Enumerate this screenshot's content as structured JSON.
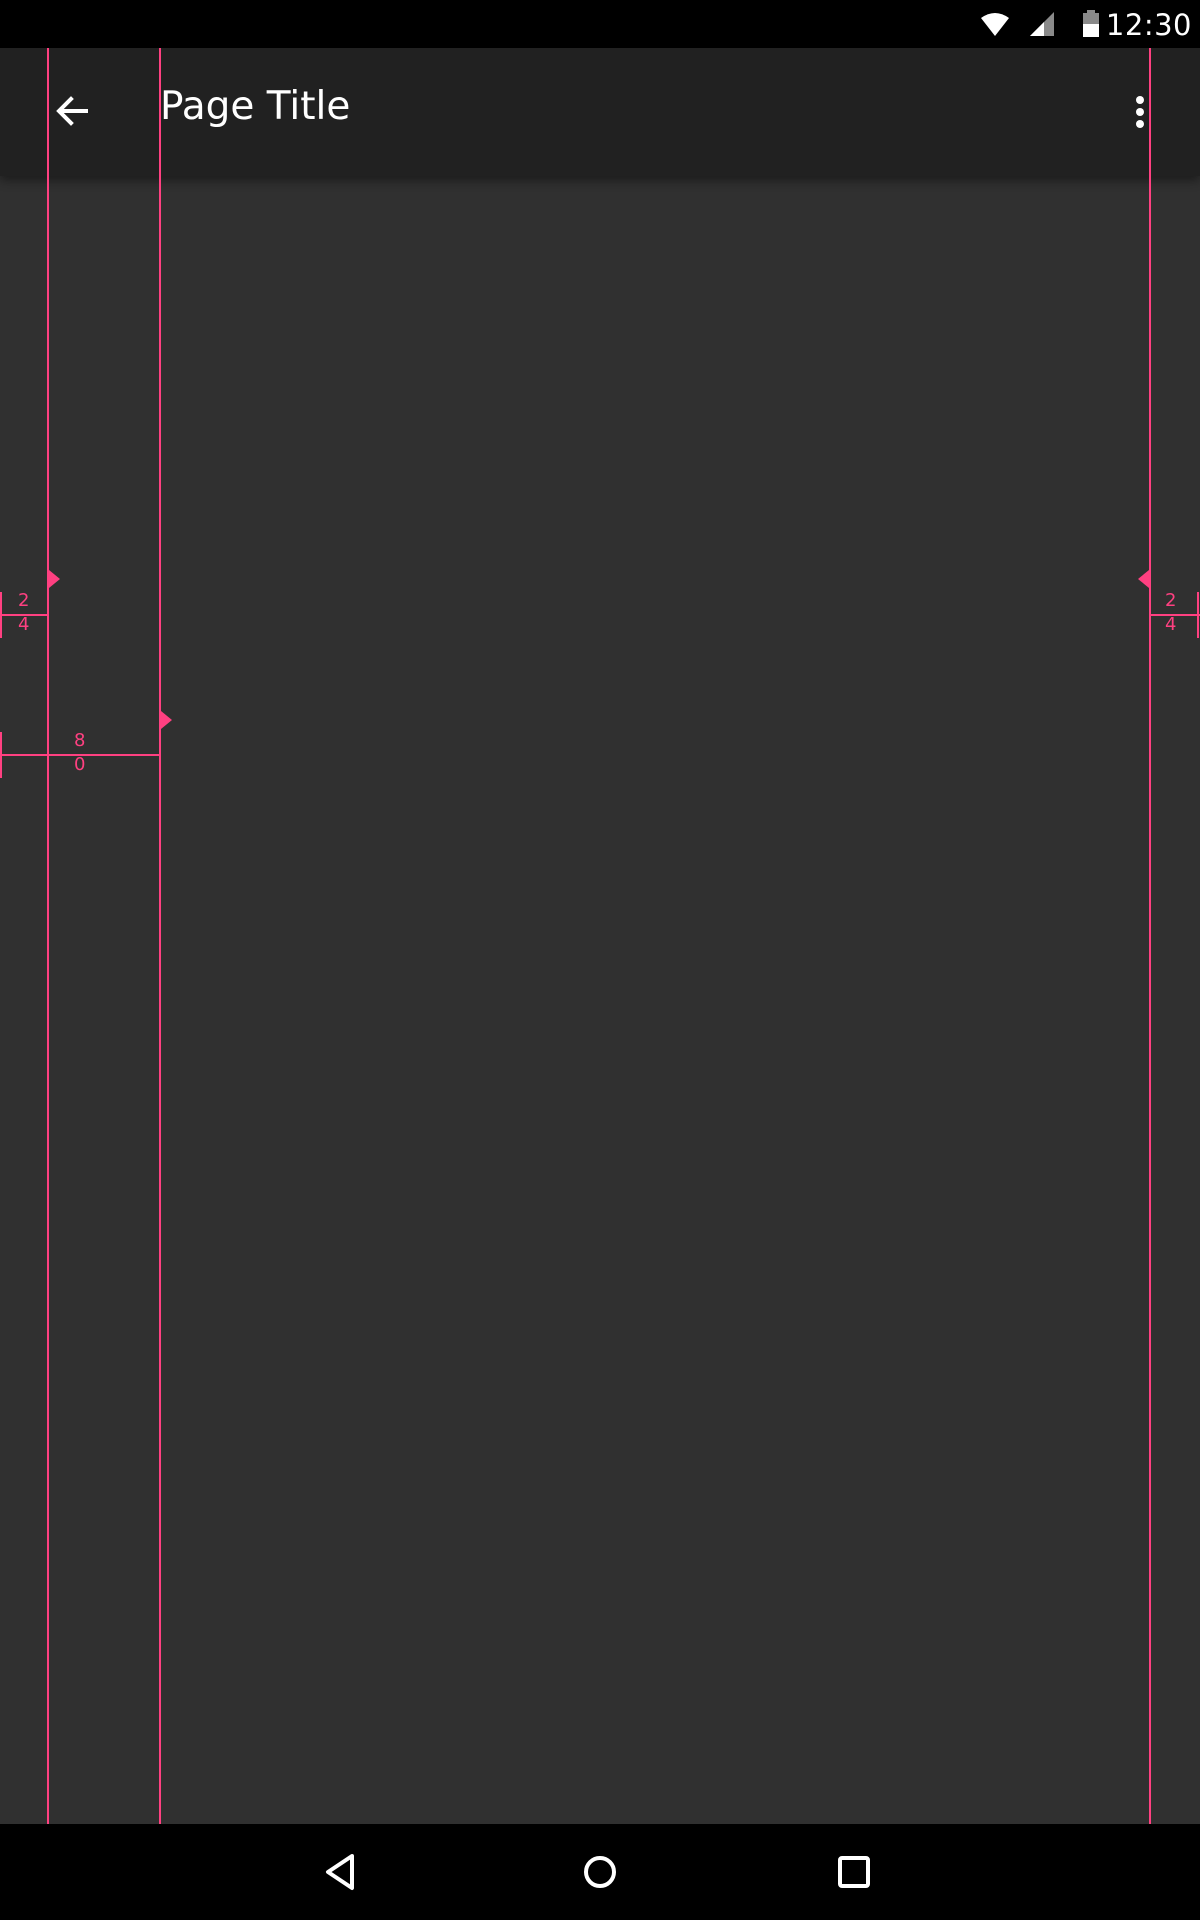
{
  "status_bar": {
    "time": "12:30",
    "icons": [
      "wifi-icon",
      "cell-signal-icon",
      "battery-icon"
    ]
  },
  "app_bar": {
    "title": "Page Title",
    "back_icon": "arrow-back-icon",
    "overflow_icon": "more-vert-icon"
  },
  "keylines": {
    "left_margin_label": [
      "2",
      "4"
    ],
    "content_inset_label": [
      "8",
      "0"
    ],
    "right_margin_label": [
      "2",
      "4"
    ]
  },
  "nav_bar": {
    "icons": [
      "nav-back-icon",
      "nav-home-icon",
      "nav-recents-icon"
    ]
  },
  "colors": {
    "background": "#303030",
    "app_bar": "#212121",
    "system_bars": "#000000",
    "keyline": "#ff4081",
    "text": "#ffffff"
  }
}
